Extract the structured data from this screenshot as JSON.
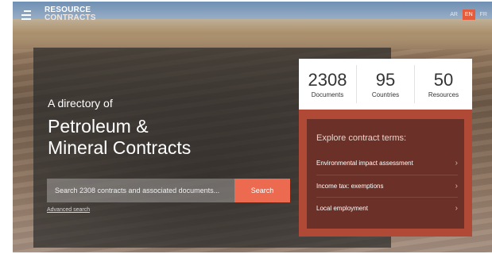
{
  "header": {
    "logo_line1": "RESOURCE",
    "logo_line2": "CONTRACTS",
    "languages": [
      {
        "code": "AR",
        "active": false
      },
      {
        "code": "EN",
        "active": true
      },
      {
        "code": "FR",
        "active": false
      }
    ]
  },
  "hero": {
    "intro": "A directory of",
    "title_line1": "Petroleum &",
    "title_line2": "Mineral Contracts"
  },
  "search": {
    "placeholder": "Search 2308 contracts and associated documents...",
    "button_label": "Search",
    "advanced_link": "Advanced search"
  },
  "stats": [
    {
      "value": "2308",
      "label": "Documents"
    },
    {
      "value": "95",
      "label": "Countries"
    },
    {
      "value": "50",
      "label": "Resources"
    }
  ],
  "explore": {
    "title": "Explore contract terms:",
    "terms": [
      {
        "label": "Environmental impact assessment"
      },
      {
        "label": "Income tax: exemptions"
      },
      {
        "label": "Local employment"
      }
    ]
  },
  "colors": {
    "accent": "#ec6a4f",
    "explore_outer": "#b04a37",
    "explore_inner": "#6b3027"
  }
}
